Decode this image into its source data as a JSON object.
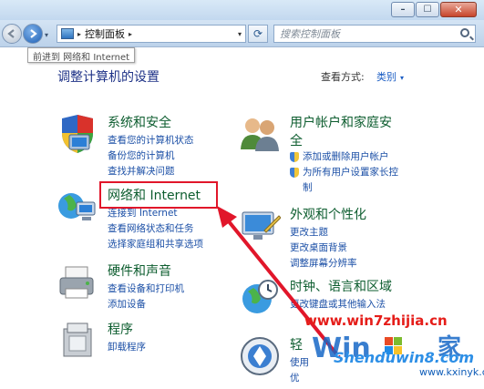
{
  "window": {
    "min_glyph": "–",
    "max_glyph": "☐",
    "close_glyph": "✕"
  },
  "address": {
    "separator": "▸",
    "crumb": "控制面板",
    "crumb_sep": "▸",
    "dropdown": "▾"
  },
  "search": {
    "placeholder": "搜索控制面板"
  },
  "tooltip": "前进到 网络和 Internet",
  "page_title": "调整计算机的设置",
  "view": {
    "label": "查看方式:",
    "value": "类别",
    "caret": "▾"
  },
  "categories": {
    "system": {
      "title": "系统和安全",
      "links": [
        "查看您的计算机状态",
        "备份您的计算机",
        "查找并解决问题"
      ]
    },
    "network": {
      "title": "网络和 Internet",
      "links": [
        "连接到 Internet",
        "查看网络状态和任务",
        "选择家庭组和共享选项"
      ]
    },
    "hardware": {
      "title": "硬件和声音",
      "links": [
        "查看设备和打印机",
        "添加设备"
      ]
    },
    "programs": {
      "title": "程序",
      "links": [
        "卸载程序"
      ]
    },
    "users": {
      "title_line1": "用户帐户和家庭安",
      "title_line2": "全",
      "links": [
        "添加或删除用户帐户",
        "为所有用户设置家长控",
        "制"
      ]
    },
    "appearance": {
      "title": "外观和个性化",
      "links": [
        "更改主题",
        "更改桌面背景",
        "调整屏幕分辨率"
      ]
    },
    "clock": {
      "title": "时钟、语言和区域",
      "links": [
        "更改键盘或其他输入法"
      ]
    },
    "ease": {
      "title": "轻",
      "links": [
        "使用",
        "优"
      ]
    }
  },
  "watermarks": {
    "site1": "www.win7zhijia.cn",
    "site2": "Shenduwin8.com",
    "site3": "www.kxinyk.com"
  },
  "colors": {
    "highlight": "#e1162a",
    "arrow": "#e1162a",
    "link": "#1b4fa6",
    "category_title": "#0d5d2f"
  }
}
